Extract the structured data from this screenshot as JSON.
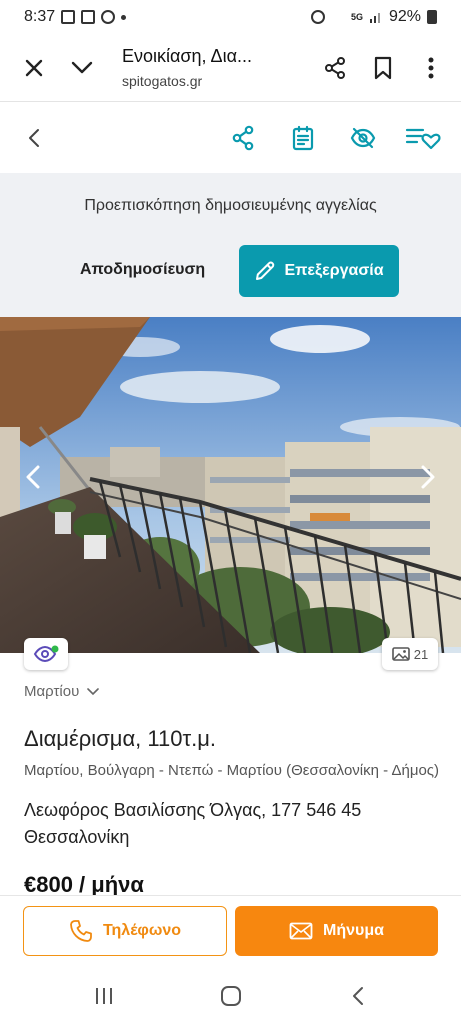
{
  "status_bar": {
    "time": "8:37",
    "network": "5G",
    "battery": "92%"
  },
  "browser": {
    "title": "Ενοικίαση, Δια...",
    "domain": "spitogatos.gr"
  },
  "preview": {
    "text": "Προεπισκόπηση δημοσιευμένης αγγελίας",
    "unpublish_label": "Αποδημοσίευση",
    "edit_label": "Επεξεργασία"
  },
  "photo": {
    "count": "21"
  },
  "listing": {
    "area": "Μαρτίου",
    "title": "Διαμέρισμα, 110τ.μ.",
    "location": "Μαρτίου, Βούλγαρη - Ντεπώ - Μαρτίου (Θεσσαλονίκη - Δήμος)",
    "address": "Λεωφόρος Βασιλίσσης Όλγας, 177 546 45 Θεσσαλονίκη",
    "price": "€800 / μήνα"
  },
  "contact": {
    "phone_label": "Τηλέφωνο",
    "message_label": "Μήνυμα"
  },
  "colors": {
    "teal": "#0a9aae",
    "orange": "#f7870f"
  }
}
